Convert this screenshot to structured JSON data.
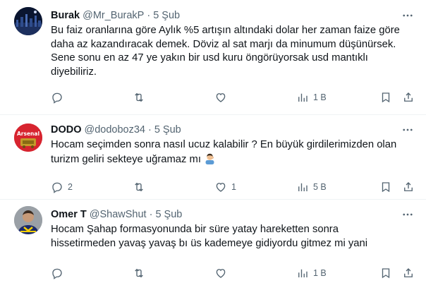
{
  "tweets": [
    {
      "name": "Burak",
      "handle": "@Mr_BurakP",
      "dot": "·",
      "date": "5 Şub",
      "text": "Bu faiz oranlarına göre Aylık %5 artışın altındaki dolar her zaman faize göre\ndaha az kazandıracak demek. Döviz al sat marjı da minumum düşünürsek.\nSene sonu en az 47 ye yakın bir usd kuru öngörüyorsak usd mantıklı\ndiyebiliriz.",
      "reply_count": "",
      "retweet_count": "",
      "like_count": "",
      "views_count": "1 B"
    },
    {
      "name": "DODO",
      "handle": "@dodoboz34",
      "dot": "·",
      "date": "5 Şub",
      "text": "Hocam seçimden sonra nasıl ucuz kalabilir ? En büyük girdilerimizden olan\nturizm geliri sekteye uğramaz mı ",
      "reply_count": "2",
      "retweet_count": "",
      "like_count": "1",
      "views_count": "5 B"
    },
    {
      "name": "Omer T",
      "handle": "@ShawShut",
      "dot": "·",
      "date": "5 Şub",
      "text": "Hocam Şahap formasyonunda bir süre yatay hareketten sonra\nhissetirmeden yavaş yavaş bı üs kademeye gidiyordu gitmez mi yani",
      "reply_count": "",
      "retweet_count": "",
      "like_count": "",
      "views_count": "1 B"
    }
  ],
  "icons": {
    "reply": "reply-icon",
    "retweet": "retweet-icon",
    "like": "heart-icon",
    "views": "views-icon",
    "bookmark": "bookmark-icon",
    "share": "share-icon",
    "more": "more-icon"
  },
  "colors": {
    "text_primary": "#0f1419",
    "text_secondary": "#536471",
    "divider": "#eff3f4"
  }
}
